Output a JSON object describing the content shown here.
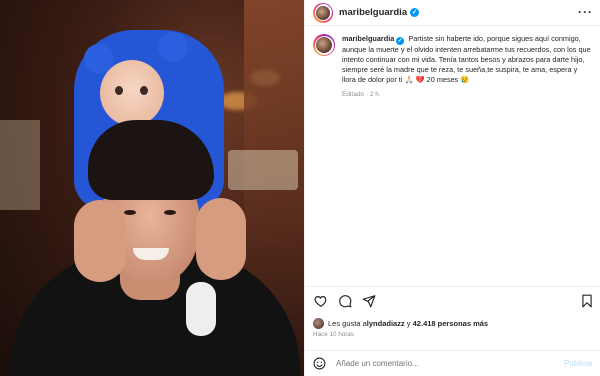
{
  "post": {
    "username": "maribelguardia",
    "verified_symbol": "✓",
    "more_icon": "more-horizontal-icon",
    "caption": {
      "username": "maribelguardia",
      "text": "Partiste sin haberte ido, porque sigues aquí conmigo, aunque la muerte y el olvido intenten arrebatarme tus recuerdos, con los que intento continuar con mi vida. Tenía tantos besos y abrazos para darte hijo, siempre seré la madre que te reza, te sueña,te suspira, te ama, espera y llora de dolor por ti 🙏🏻 💔 20 meses 😢",
      "meta": "Editado · 2 h"
    },
    "actions": {
      "like_icon": "heart-icon",
      "comment_icon": "comment-icon",
      "share_icon": "send-icon",
      "save_icon": "bookmark-icon"
    },
    "likes": {
      "prefix": "Les gusta a ",
      "user": "lyndadiazz",
      "middle": " y ",
      "count": "42.418 personas más"
    },
    "time_ago": "Hace 10 horas",
    "comment": {
      "emoji_icon": "emoji-icon",
      "placeholder": "Añade un comentario...",
      "post_label": "Publicar"
    }
  },
  "colors": {
    "verified": "#0095f6",
    "post_button_disabled": "#b2dffc",
    "border": "#efefef",
    "secondary_text": "#8e8e8e"
  }
}
